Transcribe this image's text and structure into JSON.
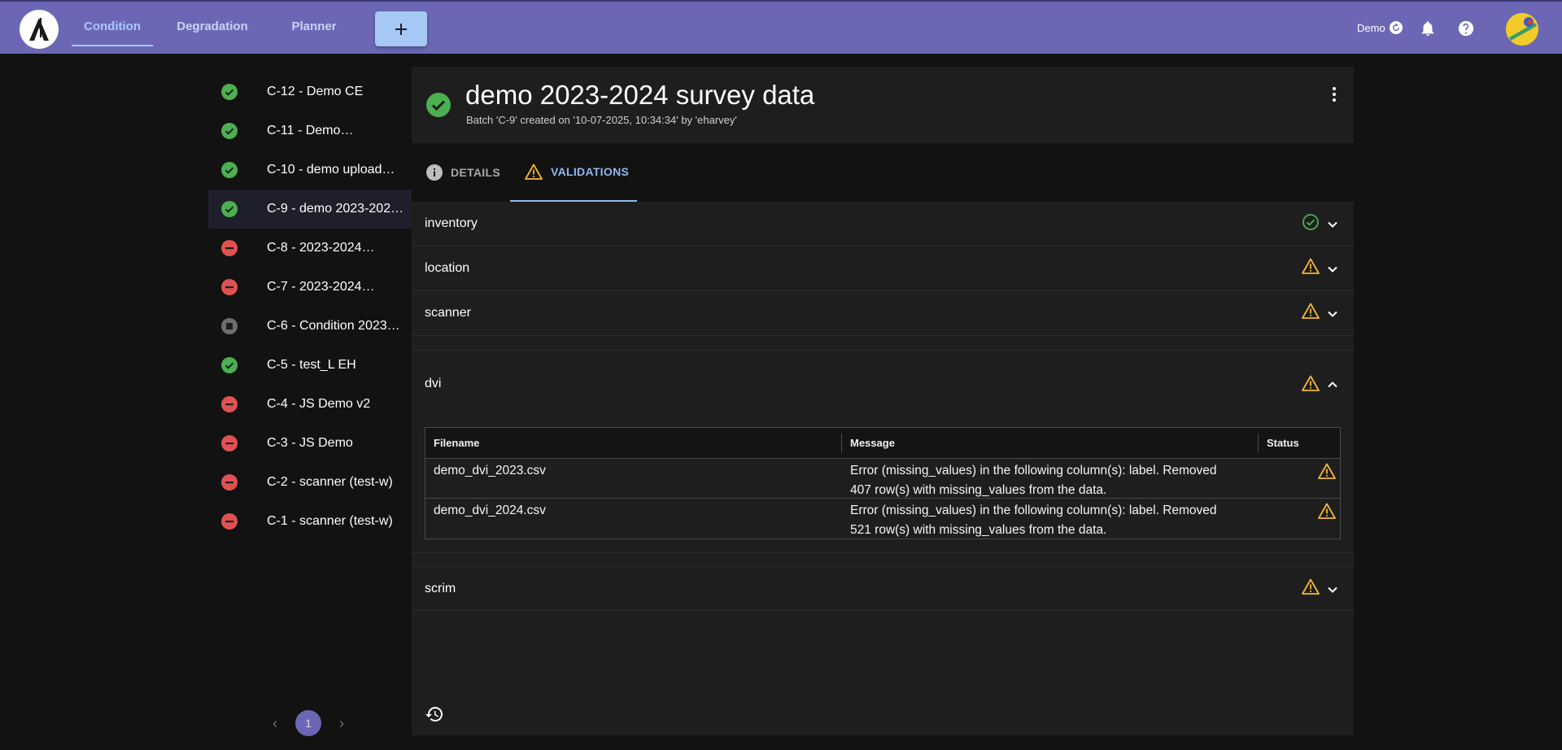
{
  "colors": {
    "topbar": "#6b67b5",
    "accent": "#a9c9ff",
    "success": "#4caf50",
    "error": "#e05252",
    "warning": "#f5b833",
    "stopped": "#6e6e6e"
  },
  "topbar": {
    "logo_icon": "app-logo",
    "tabs": [
      {
        "label": "Condition",
        "active": true
      },
      {
        "label": "Degradation",
        "active": false
      },
      {
        "label": "Planner",
        "active": false
      }
    ],
    "add_icon": "plus-icon",
    "user_label": "Demo",
    "icons": [
      "refresh-icon",
      "bell-icon",
      "help-icon",
      "avatar"
    ]
  },
  "sidebar": {
    "items": [
      {
        "label": "C-12 - Demo CE",
        "status": "success"
      },
      {
        "label": "C-11 - Demo…",
        "status": "success"
      },
      {
        "label": "C-10 - demo upload…",
        "status": "success"
      },
      {
        "label": "C-9 - demo 2023-202…",
        "status": "success",
        "selected": true
      },
      {
        "label": "C-8 - 2023-2024…",
        "status": "error"
      },
      {
        "label": "C-7 - 2023-2024…",
        "status": "error"
      },
      {
        "label": "C-6 - Condition 2023…",
        "status": "stopped"
      },
      {
        "label": "C-5 - test_L EH",
        "status": "success"
      },
      {
        "label": "C-4 - JS Demo v2",
        "status": "error"
      },
      {
        "label": "C-3 - JS Demo",
        "status": "error"
      },
      {
        "label": "C-2 - scanner (test-w)",
        "status": "error"
      },
      {
        "label": "C-1 - scanner (test-w)",
        "status": "error"
      }
    ],
    "pagination": {
      "current_page": "1"
    }
  },
  "main": {
    "title": "demo 2023-2024 survey data",
    "subtitle": "Batch 'C-9' created on '10-07-2025, 10:34:34' by 'eharvey'",
    "status": "success",
    "tabs": [
      {
        "label": "DETAILS",
        "icon": "info-icon",
        "active": false
      },
      {
        "label": "VALIDATIONS",
        "icon": "warning-icon",
        "active": true
      }
    ],
    "validations": [
      {
        "name": "inventory",
        "status": "success",
        "expanded": false
      },
      {
        "name": "location",
        "status": "warning",
        "expanded": false
      },
      {
        "name": "scanner",
        "status": "warning",
        "expanded": false
      },
      {
        "name": "dvi",
        "status": "warning",
        "expanded": true,
        "table": {
          "columns": [
            "Filename",
            "Message",
            "Status"
          ],
          "rows": [
            {
              "filename": "demo_dvi_2023.csv",
              "message_line1": "Error (missing_values) in the following column(s): label. Removed",
              "message_line2": "407 row(s) with missing_values from the data.",
              "status": "warning"
            },
            {
              "filename": "demo_dvi_2024.csv",
              "message_line1": "Error (missing_values) in the following column(s): label. Removed",
              "message_line2": "521 row(s) with missing_values from the data.",
              "status": "warning"
            }
          ]
        }
      },
      {
        "name": "scrim",
        "status": "warning",
        "expanded": false
      }
    ],
    "history_icon": "history-icon"
  }
}
